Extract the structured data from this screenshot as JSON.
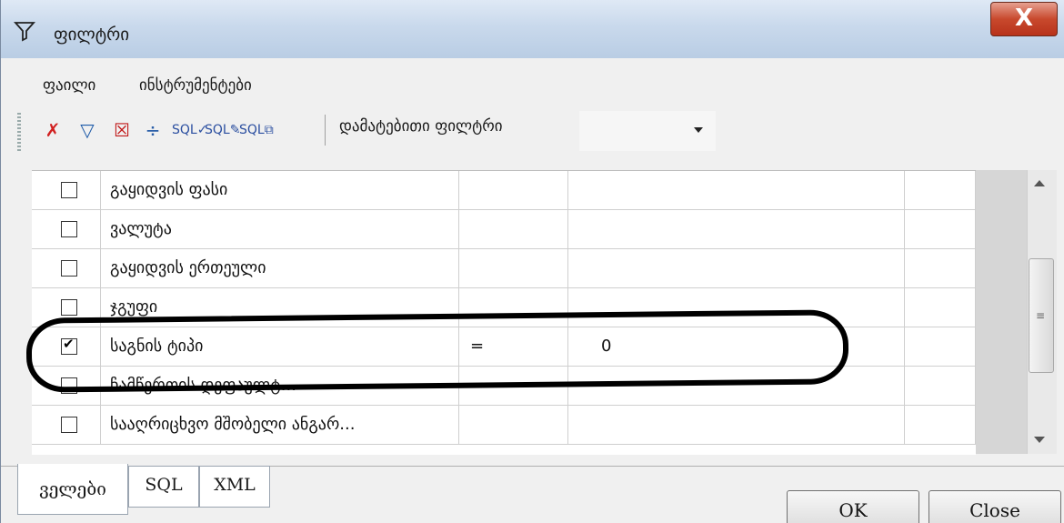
{
  "window": {
    "title": "ფილტრი",
    "close_glyph": "X"
  },
  "menu": {
    "items": [
      "ფაილი",
      "ინსტრუმენტები"
    ]
  },
  "toolbar": {
    "icons": [
      "clear-filter-icon",
      "filter-icon",
      "check-red-icon",
      "separator-icon",
      "sql-check-icon",
      "sql-edit-icon",
      "sql-copy-icon"
    ],
    "label": "დამატებითი ფილტრი",
    "combo_value": ""
  },
  "grid": {
    "rows": [
      {
        "checked": false,
        "field": "გაყიდვის ფასი",
        "op": "",
        "value": ""
      },
      {
        "checked": false,
        "field": "ვალუტა",
        "op": "",
        "value": ""
      },
      {
        "checked": false,
        "field": "გაყიდვის ერთეული",
        "op": "",
        "value": ""
      },
      {
        "checked": false,
        "field": "ჯგუფი",
        "op": "",
        "value": ""
      },
      {
        "checked": true,
        "field": "საგნის ტიპი",
        "op": "=",
        "value": "0"
      },
      {
        "checked": false,
        "field": "ჩამწერთის დეფაულტ...",
        "op": "",
        "value": ""
      },
      {
        "checked": false,
        "field": "სააღრიცხვო მშობელი ანგარ...",
        "op": "",
        "value": ""
      }
    ]
  },
  "tabs": [
    "ველები",
    "SQL",
    "XML"
  ],
  "buttons": {
    "ok": "OK",
    "close": "Close"
  },
  "colors": {
    "close_red": "#c8492d",
    "title_blue": "#c9d9ec"
  }
}
